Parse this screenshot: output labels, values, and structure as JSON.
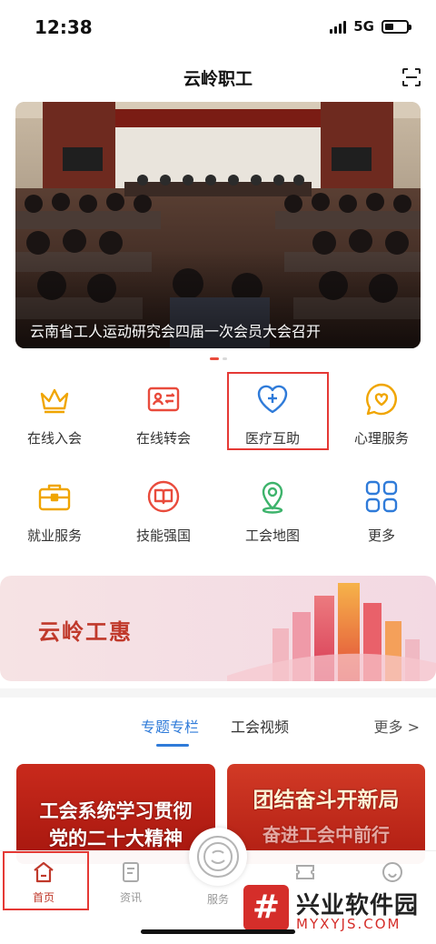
{
  "status_bar": {
    "time": "12:38",
    "network": "5G"
  },
  "header": {
    "title": "云岭职工",
    "scan_icon": "scan-icon"
  },
  "banner": {
    "caption": "云南省工人运动研究会四届一次会员大会召开",
    "slide_count": 2,
    "active_slide": 1
  },
  "quick_services": [
    {
      "label": "在线入会",
      "icon": "crown-icon"
    },
    {
      "label": "在线转会",
      "icon": "id-card-transfer-icon"
    },
    {
      "label": "医疗互助",
      "icon": "heart-plus-icon"
    },
    {
      "label": "心理服务",
      "icon": "heart-bubble-icon"
    },
    {
      "label": "就业服务",
      "icon": "briefcase-icon"
    },
    {
      "label": "技能强国",
      "icon": "book-icon"
    },
    {
      "label": "工会地图",
      "icon": "location-pin-icon"
    },
    {
      "label": "更多",
      "icon": "grid-icon"
    }
  ],
  "promo": {
    "title": "云岭工惠"
  },
  "content_tabs": {
    "tabs": [
      "专题专栏",
      "工会视频"
    ],
    "active": "专题专栏",
    "more": "更多 >"
  },
  "cards": [
    {
      "lines": [
        "工会系统学习贯彻",
        "党的二十大精神"
      ]
    },
    {
      "lines": [
        "团结奋斗开新局",
        "奋进工会中前行"
      ]
    }
  ],
  "tabbar": {
    "items": [
      {
        "label": "首页",
        "icon": "home-icon"
      },
      {
        "label": "资讯",
        "icon": "news-icon"
      },
      {
        "label": "服务",
        "icon": "service-icon"
      },
      {
        "label": "",
        "icon": "ticket-icon"
      },
      {
        "label": "",
        "icon": "profile-icon"
      }
    ],
    "active": "首页"
  },
  "watermark": {
    "badge": "#",
    "title": "兴业软件园",
    "subtitle": "MYXYJS.COM"
  },
  "colors": {
    "accent": "#e94b3c",
    "primary_blue": "#2f7bd9",
    "gold": "#f0a500",
    "highlight_box": "#e53935"
  }
}
